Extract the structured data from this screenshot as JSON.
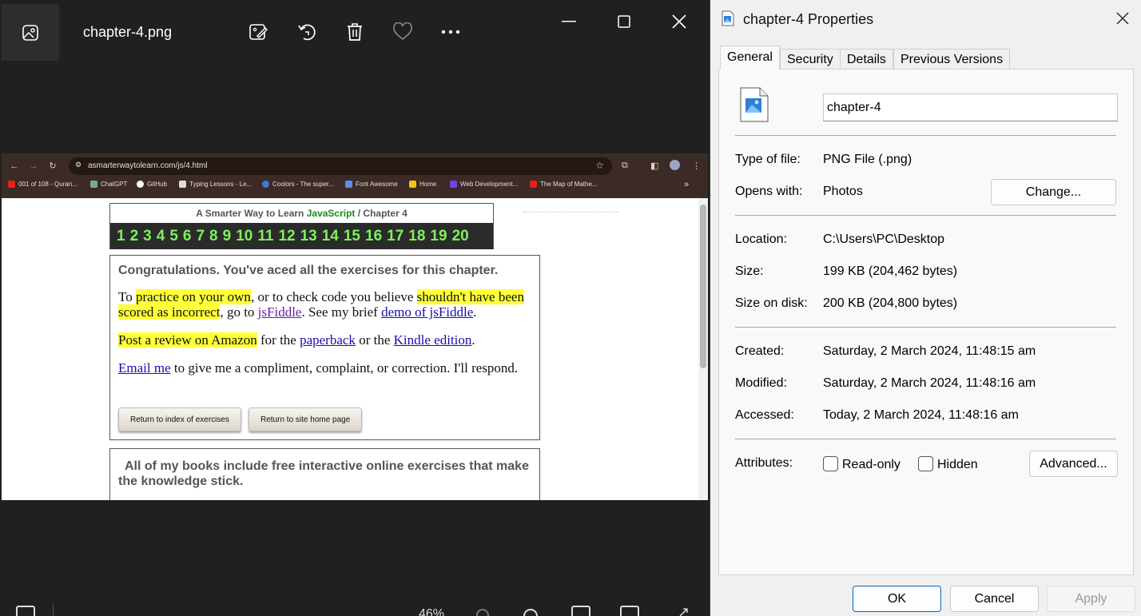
{
  "photos": {
    "file_title": "chapter-4.png",
    "zoom_level": "46%",
    "icons": [
      "photo-icon",
      "edit-icon",
      "rotate-icon",
      "delete-icon",
      "favorite-icon",
      "more-icon",
      "minimize-icon",
      "maximize-icon",
      "close-icon"
    ]
  },
  "browser": {
    "url": "asmarterwaytolearn.com/js/4.html",
    "bookmarks": [
      {
        "label": "001 of 108 - Quran...",
        "color": "#e62117"
      },
      {
        "label": "ChatGPT",
        "color": "#74aa9c"
      },
      {
        "label": "GitHub",
        "color": "#ffffff"
      },
      {
        "label": "Typing Lessons - Le...",
        "color": "#dddddd"
      },
      {
        "label": "Coolors - The super...",
        "color": "#3a7bd5"
      },
      {
        "label": "Font Awesome",
        "color": "#5a8dee"
      },
      {
        "label": "Home",
        "color": "#f4c20d"
      },
      {
        "label": "Web Development...",
        "color": "#7b3fe4"
      },
      {
        "label": "The Map of Mathe...",
        "color": "#e62117"
      }
    ]
  },
  "webpage": {
    "header_prefix": "A Smarter Way to Learn",
    "header_js": "JavaScript",
    "header_suffix": "/  Chapter 4",
    "numbers": [
      "1",
      "2",
      "3",
      "4",
      "5",
      "6",
      "7",
      "8",
      "9",
      "10",
      "11",
      "12",
      "13",
      "14",
      "15",
      "16",
      "17",
      "18",
      "19",
      "20"
    ],
    "congrats_heading": "Congratulations. You've aced all the exercises for this chapter.",
    "p1": {
      "t1": "To ",
      "h1": "practice on your own",
      "t2": ", or to check code you believe ",
      "h2": "shouldn't have been scored as incorrect",
      "t3": ", go to ",
      "l1": "jsFiddle",
      "t4": ". See my brief ",
      "l2": "demo of jsFiddle",
      "t5": "."
    },
    "p2": {
      "h1": "Post a review on Amazon",
      "t1": " for the ",
      "l1": "paperback",
      "t2": " or the ",
      "l2": "Kindle edition",
      "t3": "."
    },
    "p3": {
      "l1": "Email me",
      "t1": " to give me a compliment, complaint, or correction. I'll respond."
    },
    "btn_index": "Return to index of exercises",
    "btn_home": "Return to site home page",
    "books_text": "All of my books include free interactive online exercises that make the knowledge stick."
  },
  "properties": {
    "title": "chapter-4 Properties",
    "tabs": [
      "General",
      "Security",
      "Details",
      "Previous Versions"
    ],
    "file_name": "chapter-4",
    "type_label": "Type of file:",
    "type_value": "PNG File (.png)",
    "opens_label": "Opens with:",
    "opens_value": "Photos",
    "change_button": "Change...",
    "location_label": "Location:",
    "location_value": "C:\\Users\\PC\\Desktop",
    "size_label": "Size:",
    "size_value": "199 KB (204,462 bytes)",
    "size_disk_label": "Size on disk:",
    "size_disk_value": "200 KB (204,800 bytes)",
    "created_label": "Created:",
    "created_value": "Saturday, 2 March 2024, 11:48:15 am",
    "modified_label": "Modified:",
    "modified_value": "Saturday, 2 March 2024, 11:48:16 am",
    "accessed_label": "Accessed:",
    "accessed_value": "Today, 2 March 2024, 11:48:16 am",
    "attributes_label": "Attributes:",
    "readonly_label": "Read-only",
    "hidden_label": "Hidden",
    "advanced_button": "Advanced...",
    "ok_button": "OK",
    "cancel_button": "Cancel",
    "apply_button": "Apply"
  }
}
